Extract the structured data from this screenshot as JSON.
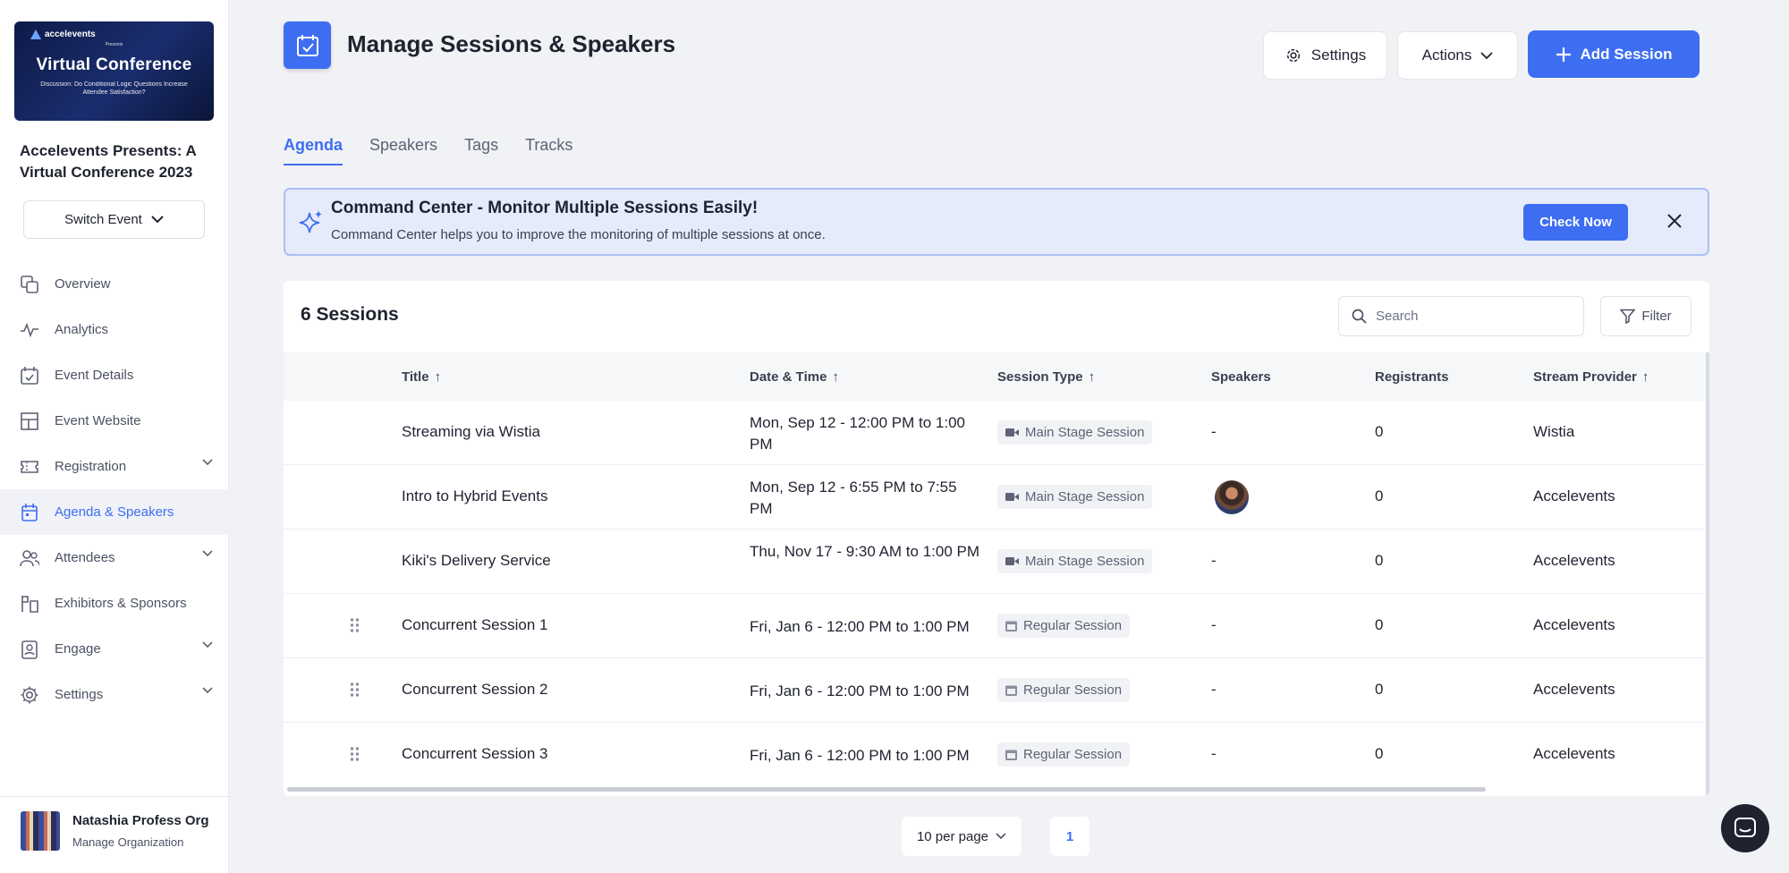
{
  "sidebar": {
    "banner": {
      "brand": "accelevents",
      "presents": "Presents",
      "title": "Virtual Conference",
      "subtitle": "Discussion: Do Conditional Logic Questions Increase Attendee Satisfaction?"
    },
    "event_name": "Accelevents Presents: A Virtual Conference 2023",
    "switch_event": "Switch Event",
    "items": [
      {
        "label": "Overview",
        "icon": "overview-icon"
      },
      {
        "label": "Analytics",
        "icon": "analytics-icon"
      },
      {
        "label": "Event Details",
        "icon": "calendar-check-icon"
      },
      {
        "label": "Event Website",
        "icon": "layout-icon"
      },
      {
        "label": "Registration",
        "icon": "ticket-icon"
      },
      {
        "label": "Agenda & Speakers",
        "icon": "calendar-icon"
      },
      {
        "label": "Attendees",
        "icon": "people-icon"
      },
      {
        "label": "Exhibitors & Sponsors",
        "icon": "booth-icon"
      },
      {
        "label": "Engage",
        "icon": "badge-icon"
      },
      {
        "label": "Settings",
        "icon": "gear-icon"
      }
    ],
    "org": {
      "name": "Natashia Profess Org",
      "sub": "Manage Organization"
    }
  },
  "header": {
    "title": "Manage Sessions & Speakers",
    "settings_label": "Settings",
    "actions_label": "Actions",
    "add_label": "Add Session"
  },
  "tabs": [
    "Agenda",
    "Speakers",
    "Tags",
    "Tracks"
  ],
  "command_center": {
    "title": "Command Center - Monitor Multiple Sessions Easily!",
    "text": "Command Center helps you to improve the monitoring of multiple sessions at once.",
    "button": "Check Now"
  },
  "table": {
    "count": "6 Sessions",
    "search_placeholder": "Search",
    "filter_label": "Filter",
    "headers": {
      "title": "Title",
      "date": "Date & Time",
      "type": "Session Type",
      "speakers": "Speakers",
      "registrants": "Registrants",
      "provider": "Stream Provider"
    },
    "rows": [
      {
        "title": "Streaming via Wistia",
        "date": "Mon, Sep 12 - 12:00 PM to 1:00 PM",
        "type": "Main Stage Session",
        "speakers": "-",
        "registrants": "0",
        "provider": "Wistia"
      },
      {
        "title": "Intro to Hybrid Events",
        "date": "Mon, Sep 12 - 6:55 PM to 7:55 PM",
        "type": "Main Stage Session",
        "speakers": "",
        "registrants": "0",
        "provider": "Accelevents"
      },
      {
        "title": "Kiki's Delivery Service",
        "date": "Thu, Nov 17 - 9:30 AM to 1:00 PM",
        "type": "Main Stage Session",
        "speakers": "-",
        "registrants": "0",
        "provider": "Accelevents"
      },
      {
        "title": "Concurrent Session 1",
        "date": "Fri, Jan 6 - 12:00 PM to 1:00 PM",
        "type": "Regular Session",
        "speakers": "-",
        "registrants": "0",
        "provider": "Accelevents"
      },
      {
        "title": "Concurrent Session 2",
        "date": "Fri, Jan 6 - 12:00 PM to 1:00 PM",
        "type": "Regular Session",
        "speakers": "-",
        "registrants": "0",
        "provider": "Accelevents"
      },
      {
        "title": "Concurrent Session 3",
        "date": "Fri, Jan 6 - 12:00 PM to 1:00 PM",
        "type": "Regular Session",
        "speakers": "-",
        "registrants": "0",
        "provider": "Accelevents"
      }
    ]
  },
  "pagination": {
    "per_page": "10 per page",
    "page": "1"
  },
  "colors": {
    "accent": "#3d6ef2",
    "banner": "#e6ebfb"
  }
}
